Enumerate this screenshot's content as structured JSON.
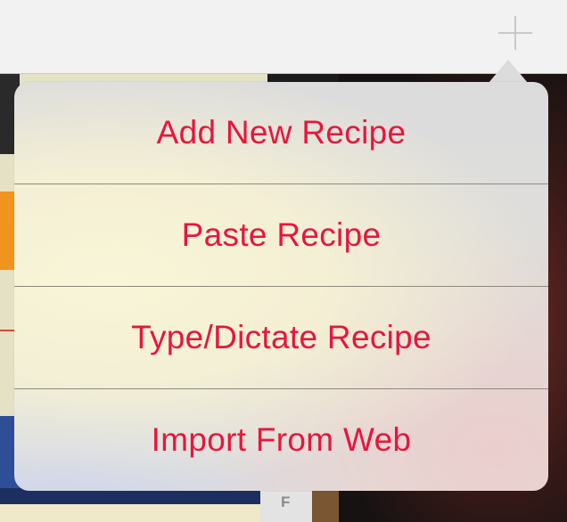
{
  "toolbar": {
    "add_icon": "plus-icon"
  },
  "background": {
    "column_letter": "F"
  },
  "popover_menu": {
    "accent_color": "#e8163c",
    "items": [
      {
        "label": "Add New Recipe"
      },
      {
        "label": "Paste Recipe"
      },
      {
        "label": "Type/Dictate Recipe"
      },
      {
        "label": "Import From Web"
      }
    ]
  }
}
